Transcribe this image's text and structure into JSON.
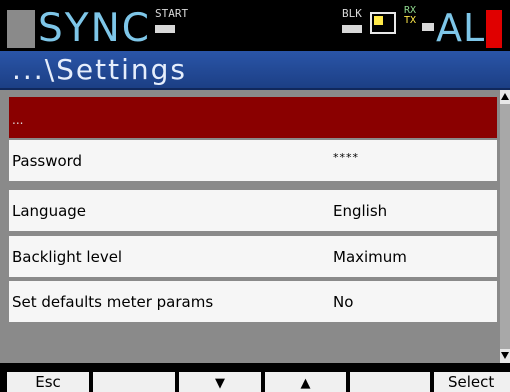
{
  "status_bar": {
    "mode_title": "SYNC",
    "start_label": "START",
    "blk_label": "BLK",
    "rx_label": "RX",
    "tx_label": "TX",
    "alarm_label": "AL",
    "colors": {
      "title": "#7ec6e8",
      "alarm": "#e00000",
      "indicator": "#ffe94a"
    },
    "icons": [
      "status-block-icon",
      "display-icon",
      "alarm-indicator-icon"
    ]
  },
  "header": {
    "title": "...\\Settings"
  },
  "settings": {
    "rows": [
      {
        "label": "...",
        "value": ""
      },
      {
        "label": "Password",
        "value": "****"
      },
      {
        "label": "Language",
        "value": "English"
      },
      {
        "label": "Backlight level",
        "value": "Maximum"
      },
      {
        "label": "Set defaults meter params",
        "value": "No"
      }
    ],
    "selected_index": 0,
    "selection_color": "#8a0000"
  },
  "softkeys": {
    "esc": "Esc",
    "empty1": "",
    "down": "▼",
    "up": "▲",
    "empty2": "",
    "select": "Select"
  }
}
